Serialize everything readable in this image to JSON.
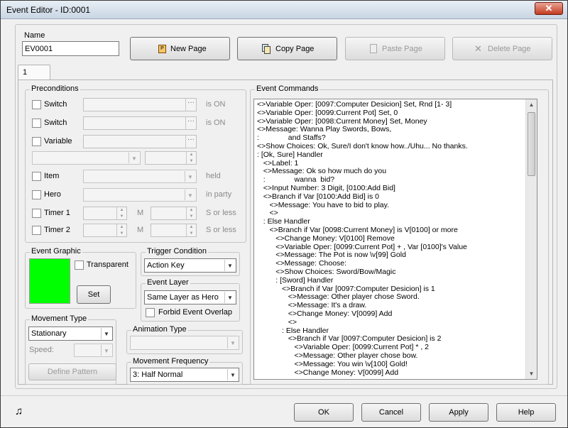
{
  "window": {
    "title": "Event Editor - ID:0001",
    "close": "✕"
  },
  "name": {
    "label": "Name",
    "value": "EV0001"
  },
  "toolbar": {
    "new_page": "New Page",
    "copy_page": "Copy Page",
    "paste_page": "Paste Page",
    "delete_page": "Delete Page"
  },
  "tabs": [
    "1"
  ],
  "preconditions": {
    "label": "Preconditions",
    "switch1": {
      "label": "Switch",
      "suffix": "is ON"
    },
    "switch2": {
      "label": "Switch",
      "suffix": "is ON"
    },
    "variable": {
      "label": "Variable"
    },
    "item": {
      "label": "Item",
      "suffix": "held"
    },
    "hero": {
      "label": "Hero",
      "suffix": "in party"
    },
    "timer1": {
      "label": "Timer 1",
      "m": "M",
      "suffix": "S or less"
    },
    "timer2": {
      "label": "Timer 2",
      "m": "M",
      "suffix": "S or less"
    }
  },
  "event_graphic": {
    "label": "Event Graphic",
    "color": "#00ff00",
    "transparent": "Transparent",
    "set": "Set"
  },
  "trigger": {
    "label": "Trigger Condition",
    "value": "Action Key"
  },
  "layer": {
    "label": "Event Layer",
    "value": "Same Layer as Hero",
    "forbid": "Forbid Event Overlap"
  },
  "movement_type": {
    "label": "Movement Type",
    "value": "Stationary",
    "speed": "Speed:",
    "define": "Define Pattern"
  },
  "animation_type": {
    "label": "Animation Type"
  },
  "movement_frequency": {
    "label": "Movement Frequency",
    "value": "3: Half Normal"
  },
  "event_commands": {
    "label": "Event Commands",
    "lines": [
      "<>Variable Oper: [0097:Computer Desicion] Set, Rnd [1- 3]",
      "<>Variable Oper: [0099:Current Pot] Set, 0",
      "<>Variable Oper: [0098:Current Money] Set, Money",
      "<>Message: Wanna Play Swords, Bows,",
      ":              and Staffs?",
      "<>Show Choices: Ok, Sure/I don't know how../Uhu... No thanks.",
      ": [Ok, Sure] Handler",
      "   <>Label: 1",
      "   <>Message: Ok so how much do you",
      "   :              wanna  bid?",
      "   <>Input Number: 3 Digit, [0100:Add Bid]",
      "   <>Branch if Var [0100:Add Bid] is 0",
      "      <>Message: You have to bid to play.",
      "      <>",
      "   : Else Handler",
      "      <>Branch if Var [0098:Current Money] is V[0100] or more",
      "         <>Change Money: V[0100] Remove",
      "         <>Variable Oper: [0099:Current Pot] + , Var [0100]'s Value",
      "         <>Message: The Pot is now \\v[99] Gold",
      "         <>Message: Choose:",
      "         <>Show Choices: Sword/Bow/Magic",
      "         : [Sword] Handler",
      "            <>Branch if Var [0097:Computer Desicion] is 1",
      "               <>Message: Other player chose Sword.",
      "               <>Message: It's a draw.",
      "               <>Change Money: V[0099] Add",
      "               <>",
      "            : Else Handler",
      "               <>Branch if Var [0097:Computer Desicion] is 2",
      "                  <>Variable Oper: [0099:Current Pot] * , 2",
      "                  <>Message: Other player chose bow.",
      "                  <>Message: You win \\v[100] Gold!",
      "                  <>Change Money: V[0099] Add"
    ]
  },
  "footer": {
    "ok": "OK",
    "cancel": "Cancel",
    "apply": "Apply",
    "help": "Help"
  }
}
